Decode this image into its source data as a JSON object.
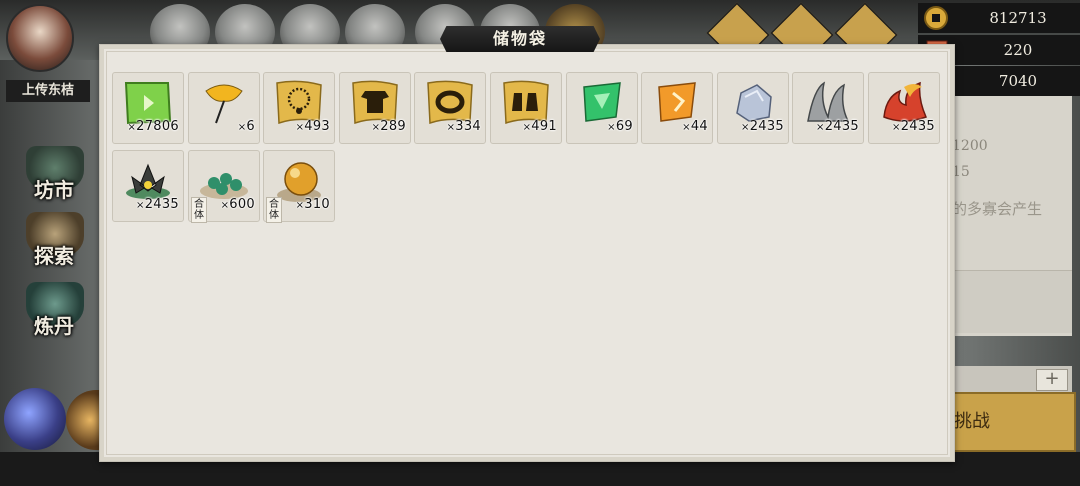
{
  "window": {
    "title": "储物袋"
  },
  "background": {
    "player_name": "上传东桔",
    "side_buttons": [
      "坊市",
      "探索",
      "炼丹"
    ],
    "right_panel_lines": [
      "1200",
      "15",
      "的多寡会产生"
    ],
    "right_button_label": "挑战",
    "plus_label": "+"
  },
  "currency": [
    {
      "icon": "copper-coin-icon",
      "value": "812713"
    },
    {
      "icon": "red-brick-icon",
      "value": "220"
    },
    {
      "icon": "jade-ring-icon",
      "value": "7040"
    }
  ],
  "inventory": [
    {
      "name": "green-scroll-icon",
      "count": "27806"
    },
    {
      "name": "ginkgo-leaf-icon",
      "count": "6"
    },
    {
      "name": "necklace-scroll-icon",
      "count": "493"
    },
    {
      "name": "robe-scroll-icon",
      "count": "289"
    },
    {
      "name": "ring-scroll-icon",
      "count": "334"
    },
    {
      "name": "boots-scroll-icon",
      "count": "491"
    },
    {
      "name": "green-talisman-icon",
      "count": "69"
    },
    {
      "name": "orange-talisman-icon",
      "count": "44"
    },
    {
      "name": "silver-ore-icon",
      "count": "2435"
    },
    {
      "name": "gray-claw-icon",
      "count": "2435"
    },
    {
      "name": "red-flame-icon",
      "count": "2435"
    },
    {
      "name": "dark-lotus-icon",
      "count": "2435"
    },
    {
      "name": "jade-beads-icon",
      "count": "600",
      "tag": "合体"
    },
    {
      "name": "golden-pearl-icon",
      "count": "310",
      "tag": "合体"
    }
  ],
  "qty_prefix": "×"
}
